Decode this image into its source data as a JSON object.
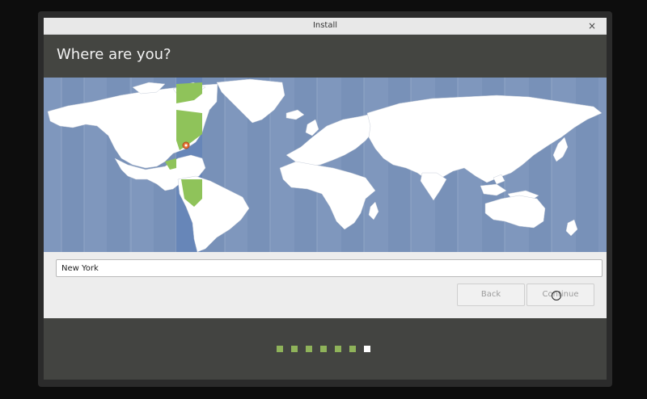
{
  "window": {
    "title": "Install",
    "close_glyph": "×"
  },
  "header": {
    "title": "Where are you?"
  },
  "map": {
    "selected_city": "New York",
    "ocean_color": "#7f97bd",
    "land_color": "#ffffff",
    "selected_zone_color": "#8fc35a",
    "marker_color": "#e8763a",
    "icon": "world-timezone-map"
  },
  "location": {
    "value": "New York"
  },
  "buttons": {
    "back": "Back",
    "continue": "Continue"
  },
  "progress": {
    "total_steps": 7,
    "current_step": 7,
    "done_color": "#8fb35a",
    "current_color": "#ffffff"
  }
}
